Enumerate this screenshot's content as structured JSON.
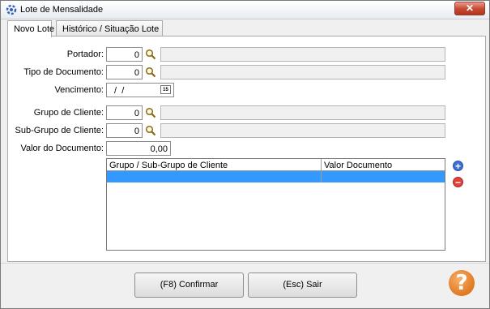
{
  "window": {
    "title": "Lote de Mensalidade",
    "close_label": "✕"
  },
  "tabs": [
    {
      "label": "Novo Lote",
      "active": true
    },
    {
      "label": "Histórico / Situação Lote",
      "active": false
    }
  ],
  "form": {
    "portador": {
      "label": "Portador:",
      "value": "0",
      "description": ""
    },
    "tipo_documento": {
      "label": "Tipo de Documento:",
      "value": "0",
      "description": ""
    },
    "vencimento": {
      "label": "Vencimento:",
      "value": " /  /",
      "calendar_label": "15"
    },
    "grupo_cliente": {
      "label": "Grupo de Cliente:",
      "value": "0",
      "description": ""
    },
    "subgrupo_cliente": {
      "label": "Sub-Grupo de Cliente:",
      "value": "0",
      "description": ""
    },
    "valor_documento": {
      "label": "Valor do Documento:",
      "value": "0,00"
    }
  },
  "grid": {
    "columns": [
      "Grupo / Sub-Grupo de Cliente",
      "Valor Documento"
    ],
    "rows": [
      [
        "",
        ""
      ]
    ]
  },
  "side_buttons": {
    "add_icon": "plus-circle-icon",
    "remove_icon": "minus-circle-icon"
  },
  "footer": {
    "confirm_label": "(F8) Confirmar",
    "exit_label": "(Esc) Sair",
    "help_label": "?"
  },
  "colors": {
    "selected_row": "#3399ff",
    "add": "#3b6fd8",
    "remove": "#e0413a",
    "help": "#e07820"
  }
}
